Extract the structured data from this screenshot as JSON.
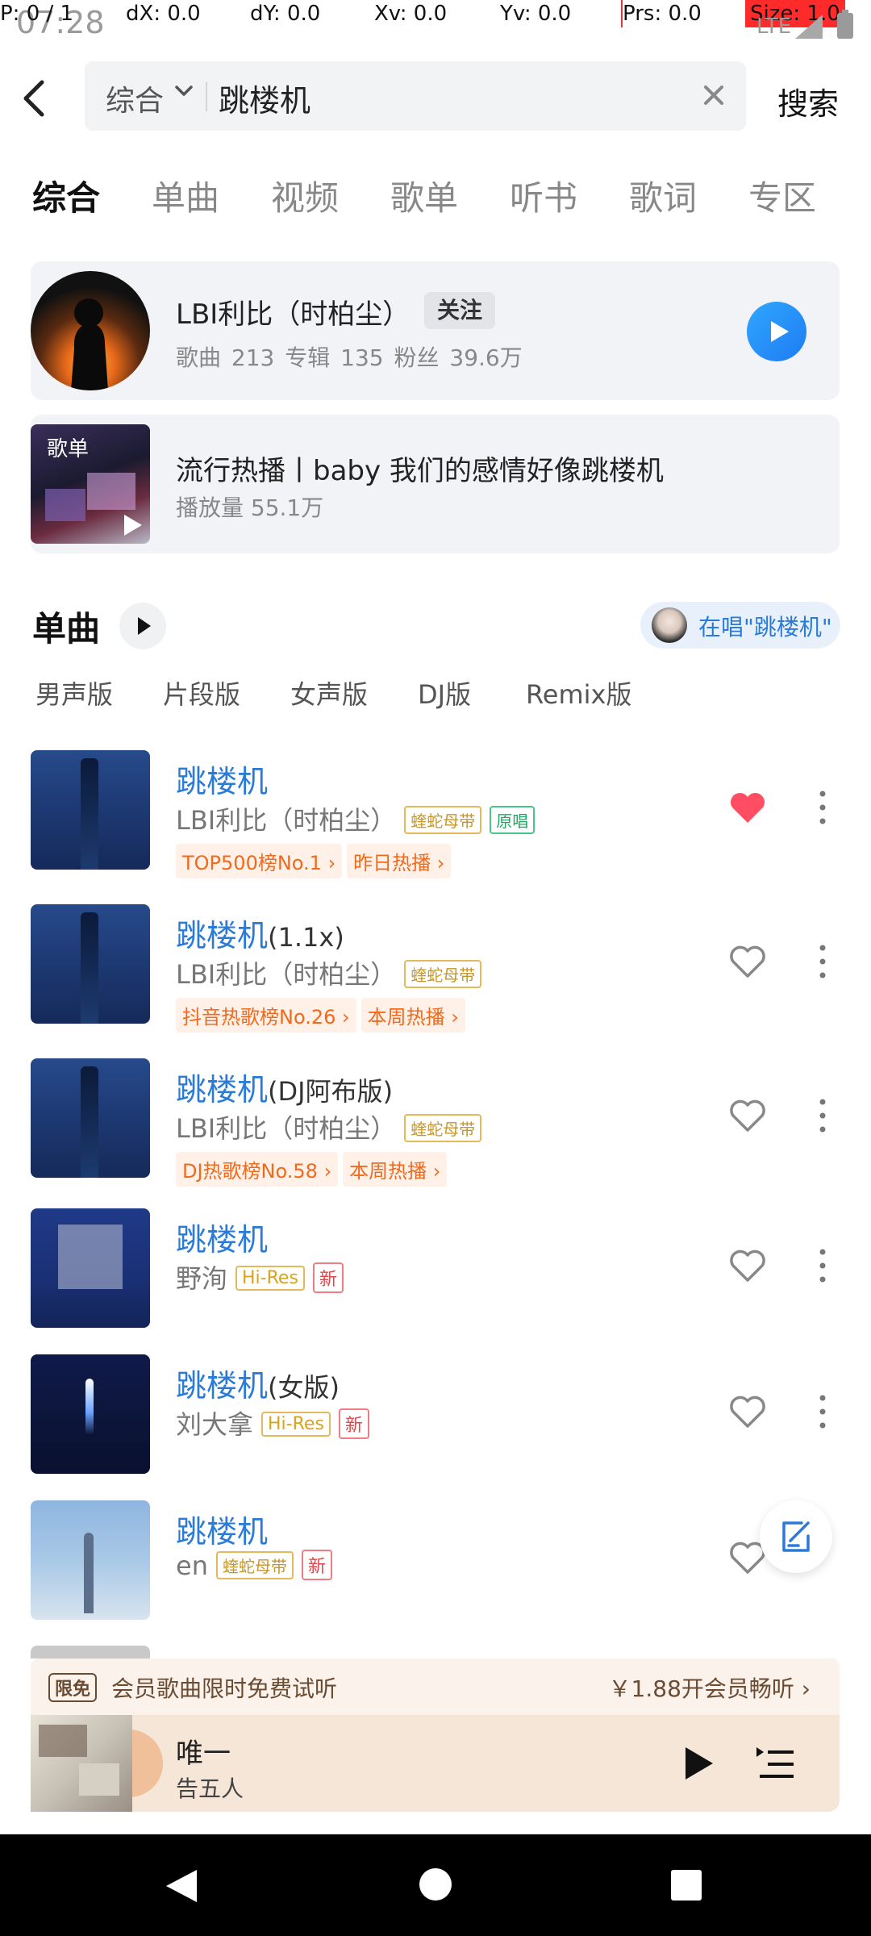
{
  "status": {
    "clock": "07:28",
    "debug": {
      "p": "P: 0 / 1",
      "dx": "dX: 0.0",
      "dy": "dY: 0.0",
      "xv": "Xv: 0.0",
      "yv": "Yv: 0.0",
      "prs": "Prs: 0.0",
      "size": "Size: 1.0"
    },
    "network": "LTE"
  },
  "search": {
    "scope": "综合",
    "query": "跳楼机",
    "submit_label": "搜索"
  },
  "tabs": [
    "综合",
    "单曲",
    "视频",
    "歌单",
    "听书",
    "歌词",
    "专区"
  ],
  "artist_card": {
    "name": "LBI利比（时柏尘）",
    "follow_label": "关注",
    "stats": "歌曲 213   专辑 135   粉丝 39.6万"
  },
  "playlist_card": {
    "tag": "歌单",
    "title": "流行热播丨baby 我们的感情好像跳楼机",
    "plays": "播放量 55.1万"
  },
  "section": {
    "title": "单曲",
    "singing_label": "在唱\"跳楼机\""
  },
  "filters": [
    "男声版",
    "片段版",
    "女声版",
    "DJ版",
    "Remix版"
  ],
  "songs": [
    {
      "title": "跳楼机",
      "suffix": "",
      "artist": "LBI利比（时柏尘）",
      "badge1": "蝰蛇母带",
      "badge2": "原唱",
      "tag1": "TOP500榜No.1 ›",
      "tag2": "昨日热播 ›",
      "liked": true
    },
    {
      "title": "跳楼机",
      "suffix": "(1.1x)",
      "artist": "LBI利比（时柏尘）",
      "badge1": "蝰蛇母带",
      "tag1": "抖音热歌榜No.26 ›",
      "tag2": "本周热播 ›",
      "liked": false
    },
    {
      "title": "跳楼机",
      "suffix": "(DJ阿布版)",
      "artist": "LBI利比（时柏尘）",
      "badge1": "蝰蛇母带",
      "tag1": "DJ热歌榜No.58 ›",
      "tag2": "本周热播 ›",
      "liked": false
    },
    {
      "title": "跳楼机",
      "suffix": "",
      "artist": "野洵",
      "badge1": "Hi-Res",
      "badge2": "新",
      "liked": false
    },
    {
      "title": "跳楼机",
      "suffix": "(女版)",
      "artist": "刘大拿",
      "badge1": "Hi-Res",
      "badge2": "新",
      "liked": false
    },
    {
      "title": "跳楼机",
      "suffix": "",
      "artist": "en",
      "badge1": "蝰蛇母带",
      "badge2": "新",
      "liked": false
    }
  ],
  "promo": {
    "badge": "限免",
    "text": "会员歌曲限时免费试听",
    "cta": "￥1.88开会员畅听 ›"
  },
  "player": {
    "title": "唯一",
    "artist": "告五人"
  },
  "colors": {
    "accent": "#2a7bd8",
    "like": "#ff4d63",
    "tag": "#f06a1e"
  },
  "icons": [
    "back-icon",
    "chevron-down-icon",
    "clear-icon",
    "play-icon",
    "heart-icon",
    "more-icon",
    "edit-icon",
    "playlist-icon"
  ]
}
